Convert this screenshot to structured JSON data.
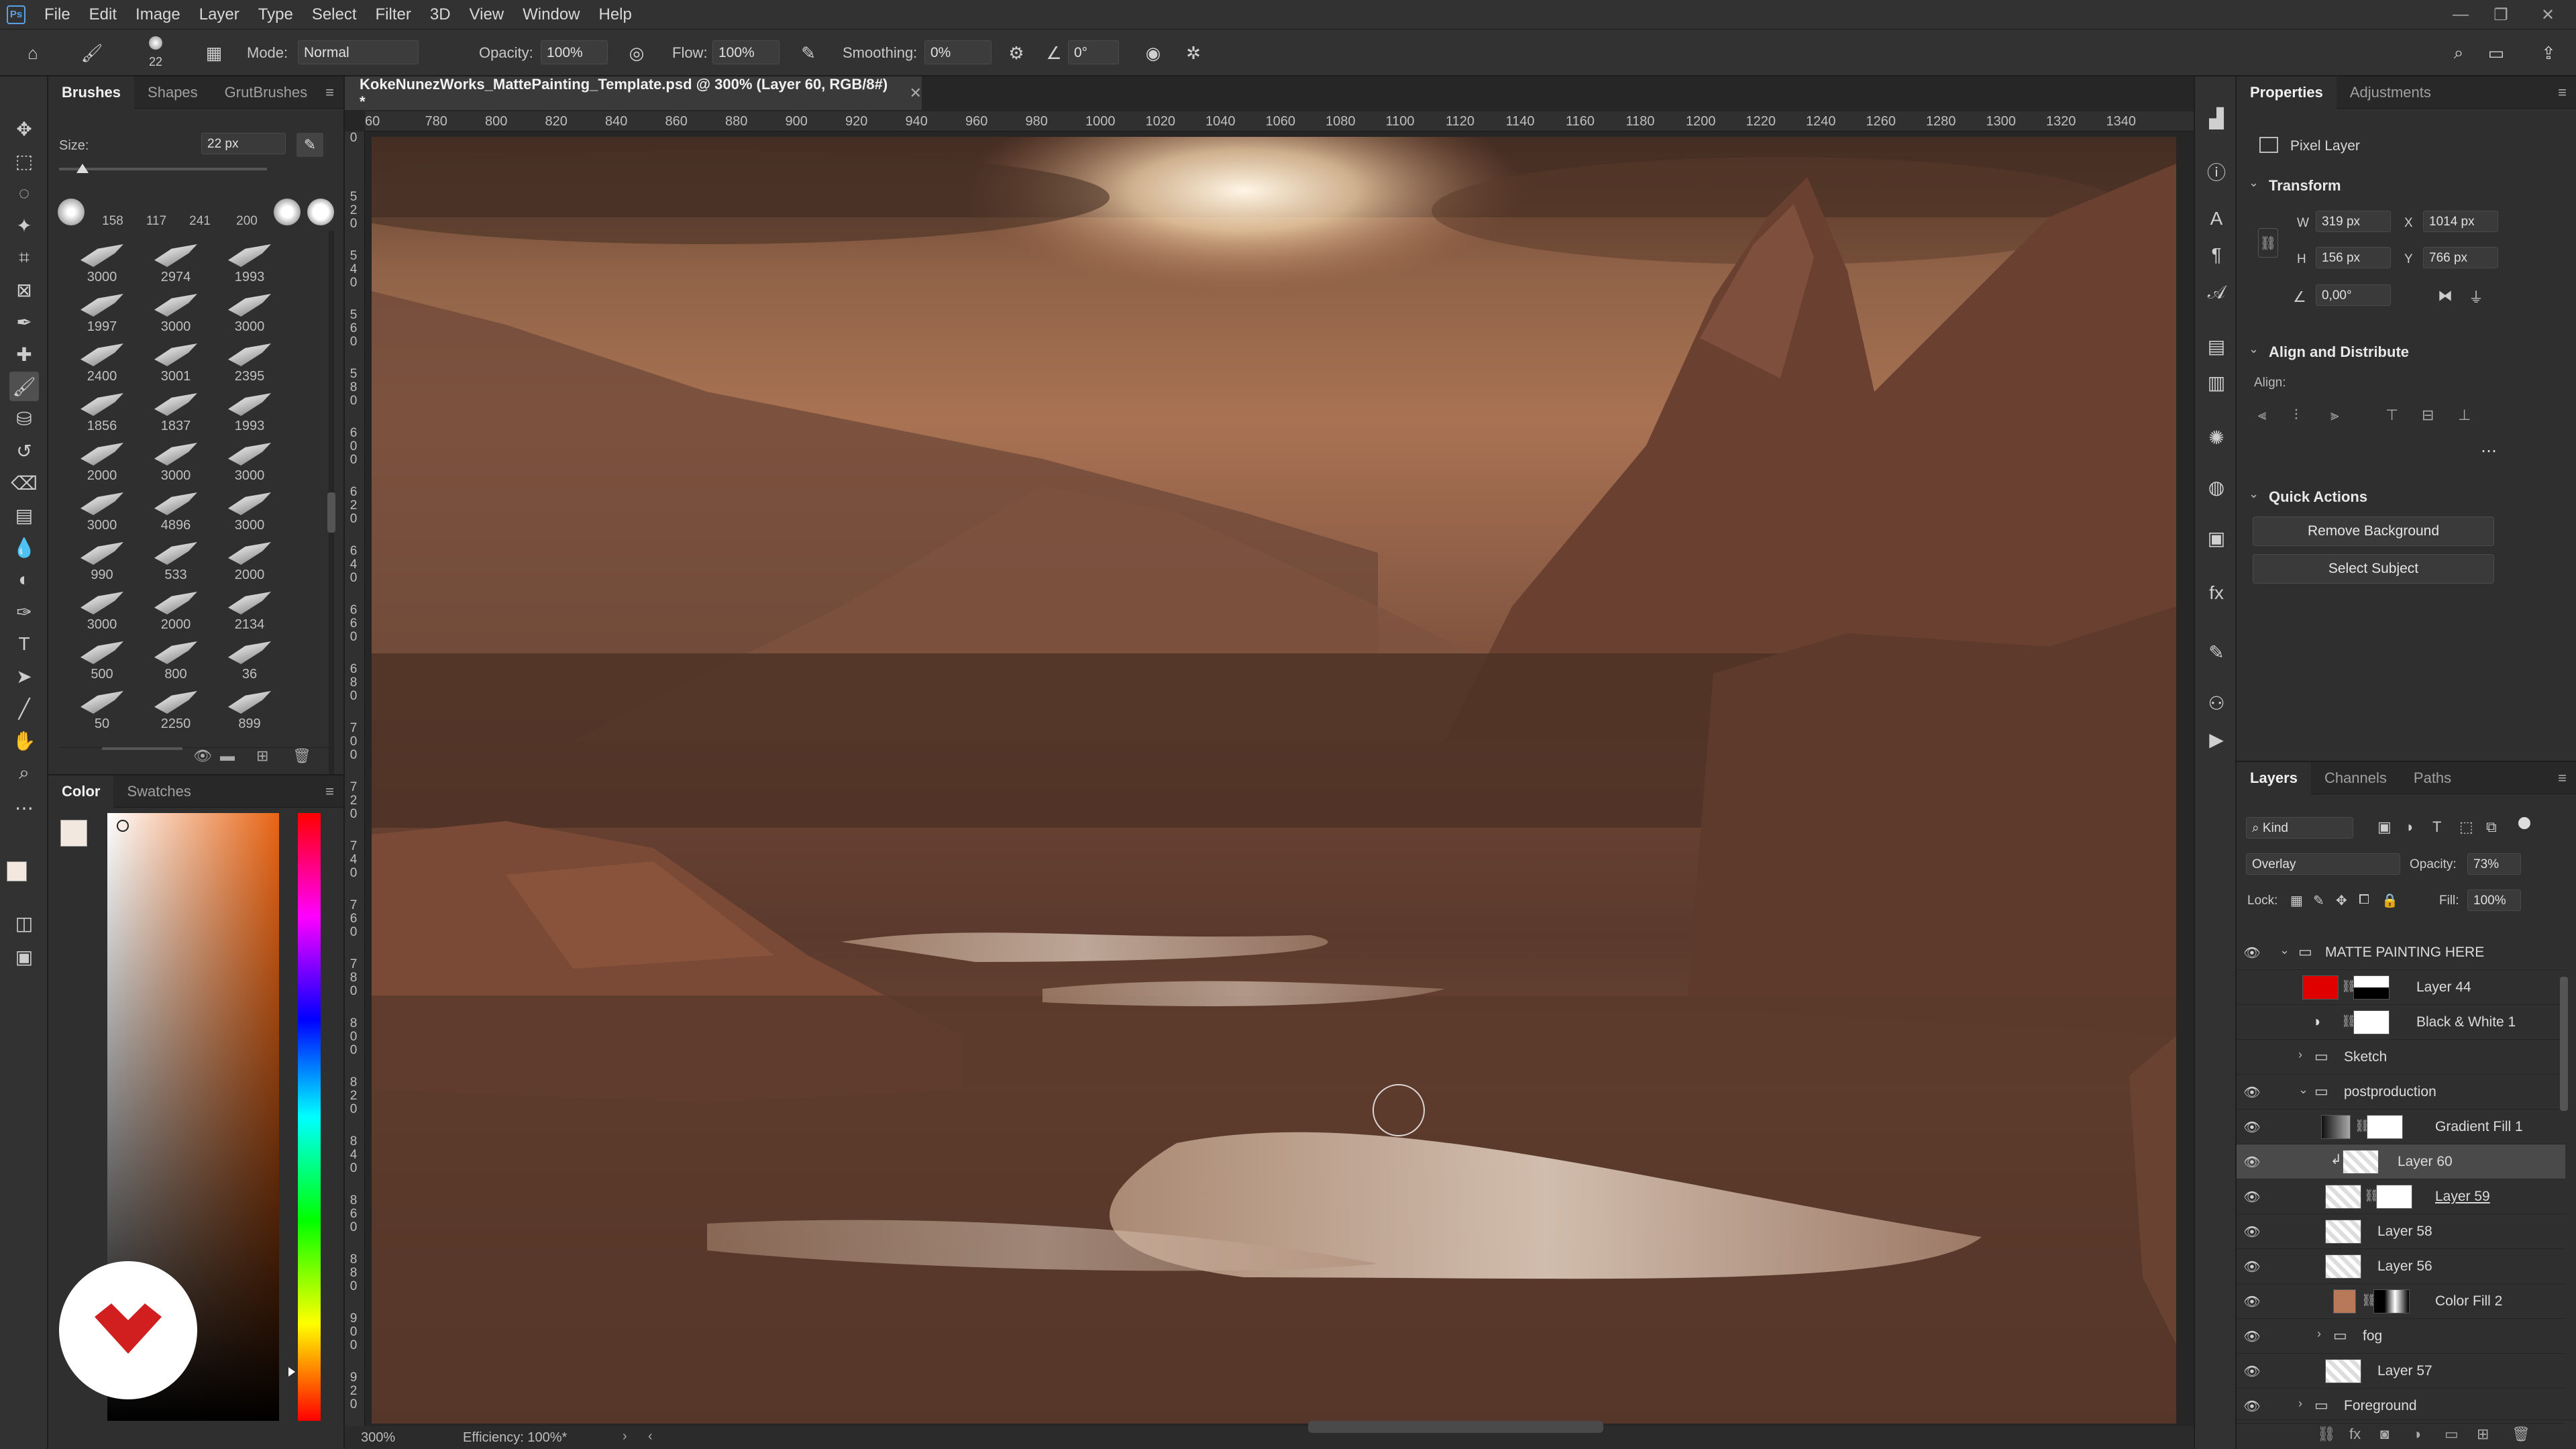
{
  "menu": {
    "items": [
      "File",
      "Edit",
      "Image",
      "Layer",
      "Type",
      "Select",
      "Filter",
      "3D",
      "View",
      "Window",
      "Help"
    ]
  },
  "options": {
    "brush_size": "22",
    "mode_label": "Mode:",
    "mode_value": "Normal",
    "opacity_label": "Opacity:",
    "opacity_value": "100%",
    "flow_label": "Flow:",
    "flow_value": "100%",
    "smoothing_label": "Smoothing:",
    "smoothing_value": "0%",
    "angle_value": "0°"
  },
  "brushes": {
    "tabs": [
      "Brushes",
      "Shapes",
      "GrutBrushes"
    ],
    "size_label": "Size:",
    "size_value": "22 px",
    "presets": [
      "158",
      "117",
      "241",
      "200"
    ],
    "grid": [
      [
        "3000",
        "2974",
        "1993"
      ],
      [
        "1997",
        "3000",
        "3000"
      ],
      [
        "2400",
        "3001",
        "2395"
      ],
      [
        "1856",
        "1837",
        "1993"
      ],
      [
        "2000",
        "3000",
        "3000"
      ],
      [
        "3000",
        "4896",
        "3000"
      ],
      [
        "990",
        "533",
        "2000"
      ],
      [
        "3000",
        "2000",
        "2134"
      ],
      [
        "500",
        "800",
        "36"
      ],
      [
        "50",
        "2250",
        "899"
      ]
    ]
  },
  "color_panel": {
    "tabs": [
      "Color",
      "Swatches"
    ]
  },
  "document": {
    "tab_title": "KokeNunezWorks_MattePainting_Template.psd @ 300% (Layer 60, RGB/8#) *",
    "ruler_top": [
      "60",
      "780",
      "800",
      "820",
      "840",
      "860",
      "880",
      "900",
      "920",
      "940",
      "960",
      "980",
      "1000",
      "1020",
      "1040",
      "1060",
      "1080",
      "1100",
      "1120",
      "1140",
      "1160",
      "1180",
      "1200",
      "1220",
      "1240",
      "1260",
      "1280",
      "1300",
      "1320",
      "1340"
    ],
    "ruler_left": [
      "0",
      "5 2 0",
      "5 4 0",
      "5 6 0",
      "5 8 0",
      "6 0 0",
      "6 2 0",
      "6 4 0",
      "6 6 0",
      "6 8 0",
      "7 0 0",
      "7 2 0",
      "7 4 0",
      "7 6 0",
      "7 8 0",
      "8 0 0",
      "8 2 0",
      "8 4 0",
      "8 6 0",
      "8 8 0",
      "9 0 0",
      "9 2 0"
    ],
    "zoom": "300%",
    "efficiency": "Efficiency: 100%*"
  },
  "properties": {
    "tabs": [
      "Properties",
      "Adjustments"
    ],
    "layer_type": "Pixel Layer",
    "transform_title": "Transform",
    "w_label": "W",
    "w_value": "319 px",
    "x_label": "X",
    "x_value": "1014 px",
    "h_label": "H",
    "h_value": "156 px",
    "y_label": "Y",
    "y_value": "766 px",
    "angle_value": "0,00°",
    "align_title": "Align and Distribute",
    "align_label": "Align:",
    "quick_title": "Quick Actions",
    "remove_bg": "Remove Background",
    "select_subject": "Select Subject"
  },
  "layers": {
    "tabs": [
      "Layers",
      "Channels",
      "Paths"
    ],
    "kind_label": "Kind",
    "blend_mode": "Overlay",
    "opacity_label": "Opacity:",
    "opacity_value": "73%",
    "lock_label": "Lock:",
    "fill_label": "Fill:",
    "fill_value": "100%",
    "rows": [
      {
        "name": "MATTE PAINTING HERE",
        "type": "group"
      },
      {
        "name": "Layer 44",
        "type": "layer"
      },
      {
        "name": "Black & White 1",
        "type": "adjustment"
      },
      {
        "name": "Sketch",
        "type": "group"
      },
      {
        "name": "postproduction",
        "type": "group"
      },
      {
        "name": "Gradient Fill 1",
        "type": "fill"
      },
      {
        "name": "Layer 60",
        "type": "layer"
      },
      {
        "name": "Layer 59",
        "type": "layer"
      },
      {
        "name": "Layer 58",
        "type": "layer"
      },
      {
        "name": "Layer 56",
        "type": "layer"
      },
      {
        "name": "Color Fill 2",
        "type": "fill"
      },
      {
        "name": "fog",
        "type": "group"
      },
      {
        "name": "Layer 57",
        "type": "layer"
      },
      {
        "name": "Foreground",
        "type": "group"
      }
    ]
  },
  "colors": {
    "accent": "#5aa0e6",
    "layer44_thumb": "#e00000",
    "colorfill_thumb": "#b8795a",
    "foreground_swatch": "#f2e8e0",
    "background_swatch": "#111111"
  }
}
